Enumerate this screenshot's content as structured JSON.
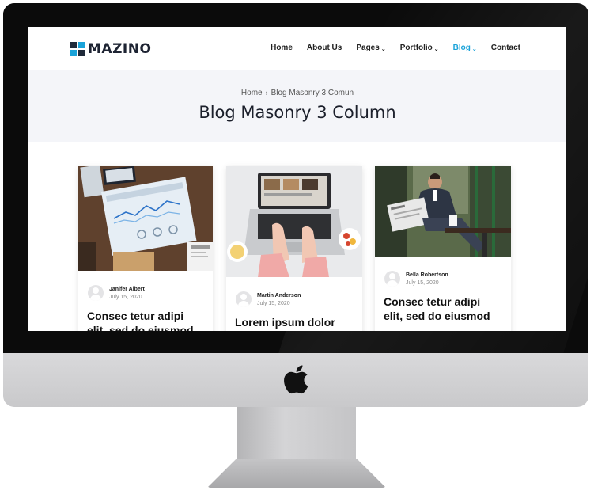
{
  "nav": {
    "logo": "MAZINO",
    "items": [
      {
        "label": "Home"
      },
      {
        "label": "About Us"
      },
      {
        "label": "Pages"
      },
      {
        "label": "Portfolio"
      },
      {
        "label": "Blog"
      },
      {
        "label": "Contact"
      }
    ]
  },
  "breadcrumb": {
    "home": "Home",
    "separator": "›",
    "current": "Blog Masonry 3 Comun"
  },
  "page_title": "Blog Masonry 3 Column",
  "posts": [
    {
      "author": "Janifer Albert",
      "date": "July 15, 2020",
      "title": "Consec tetur adipi elit, sed do eiusmod"
    },
    {
      "author": "Martin Anderson",
      "date": "July 15, 2020",
      "title": "Lorem ipsum dolor"
    },
    {
      "author": "Bella Robertson",
      "date": "July 15, 2020",
      "title": "Consec tetur adipi elit, sed do eiusmod"
    }
  ],
  "colors": {
    "accent": "#1aa3d9",
    "dark": "#1e2433",
    "hero_bg": "#f4f5f9"
  },
  "icons": {
    "brand": "apple-logo-icon",
    "chevron": "chevron-down-icon",
    "avatar": "user-avatar-icon"
  }
}
